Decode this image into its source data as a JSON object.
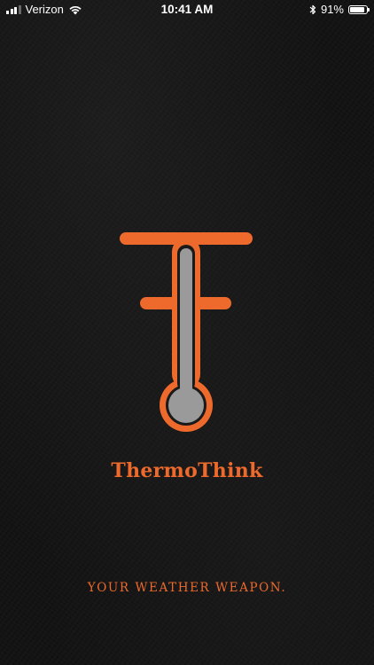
{
  "status_bar": {
    "carrier": "Verizon",
    "time": "10:41 AM",
    "battery_percent": "91%",
    "battery_level": 0.91,
    "signal_bars_active": 3,
    "signal_bars_total": 4,
    "icons": [
      "signal-bars-icon",
      "wifi-icon",
      "bluetooth-icon",
      "battery-icon"
    ]
  },
  "splash": {
    "app_name": "ThermoThink",
    "tagline": "YOUR WEATHER WEAPON.",
    "logo_icon": "thermometer-logo-icon"
  },
  "colors": {
    "accent": "#ee6a2c",
    "background": "#141414",
    "thermometer_fill": "#9a9a9a",
    "status_text": "#ffffff"
  }
}
